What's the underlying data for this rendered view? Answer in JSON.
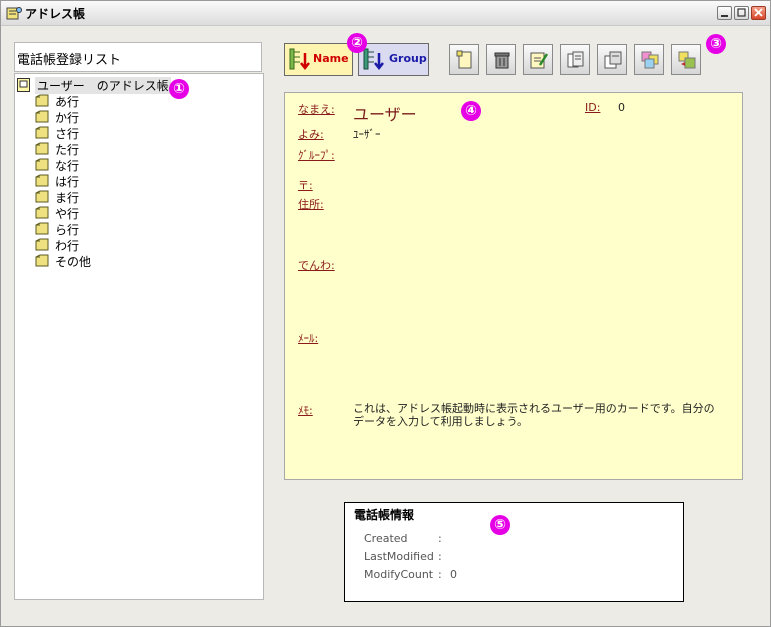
{
  "window": {
    "title": "アドレス帳"
  },
  "left_panel": {
    "list_title": "電話帳登録リスト",
    "root_label": "ユーザー　のアドレス帳",
    "items": [
      "あ行",
      "か行",
      "さ行",
      "た行",
      "な行",
      "は行",
      "ま行",
      "や行",
      "ら行",
      "わ行",
      "その他"
    ]
  },
  "sort_buttons": {
    "name_label": "Name",
    "group_label": "Group"
  },
  "toolbar": {
    "buttons": [
      "new-card-icon",
      "delete-icon",
      "edit-icon",
      "copy-icon",
      "duplicate-icon",
      "group-color-icon",
      "group-move-icon"
    ]
  },
  "card": {
    "name_label": "なまえ:",
    "name_value": "ユーザー",
    "id_label": "ID:",
    "id_value": "0",
    "yomi_label": "よみ:",
    "yomi_value": "ﾕｰｻﾞｰ",
    "group_label": "ｸﾞﾙｰﾌﾟ:",
    "zip_label": "〒:",
    "address_label": "住所:",
    "phone_label": "でんわ:",
    "mail_label": "ﾒｰﾙ:",
    "memo_label": "ﾒﾓ:",
    "memo_value": "これは、アドレス帳起動時に表示されるユーザー用のカードです。自分のデータを入力して利用しましょう。"
  },
  "info": {
    "title": "電話帳情報",
    "rows": [
      {
        "key": "Created",
        "sep": ":",
        "value": ""
      },
      {
        "key": "LastModified",
        "sep": ":",
        "value": ""
      },
      {
        "key": "ModifyCount",
        "sep": ":",
        "value": "0"
      }
    ]
  },
  "markers": [
    "①",
    "②",
    "③",
    "④",
    "⑤"
  ],
  "colors": {
    "card_bg": "#ffffcc",
    "marker": "#e600e6",
    "label": "#8b1a1a"
  }
}
